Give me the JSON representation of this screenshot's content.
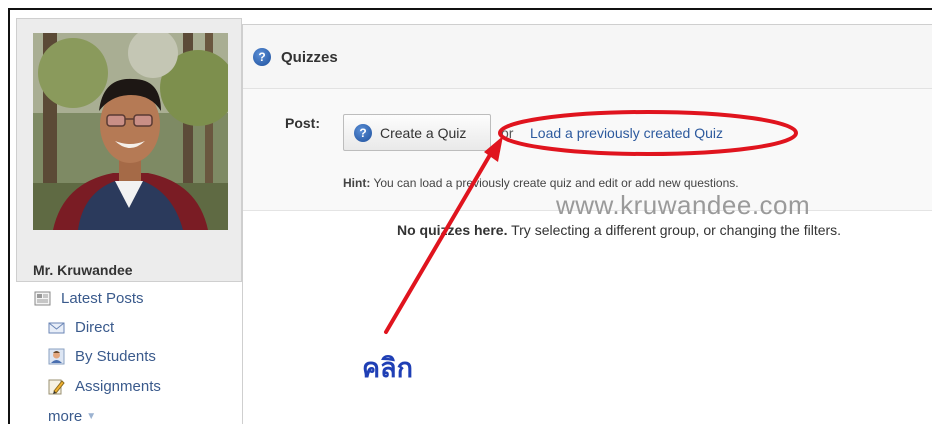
{
  "profile": {
    "name": "Mr. Kruwandee"
  },
  "nav": {
    "items": [
      {
        "label": "Latest Posts",
        "icon": "newspaper-icon"
      },
      {
        "label": "Direct",
        "icon": "envelope-icon"
      },
      {
        "label": "By Students",
        "icon": "student-icon"
      },
      {
        "label": "Assignments",
        "icon": "pencil-icon"
      }
    ],
    "more_label": "more"
  },
  "panel": {
    "title": "Quizzes",
    "post_label": "Post:",
    "create_button_label": "Create a Quiz",
    "or_text": "or",
    "load_link_label": "Load a previously created Quiz",
    "hint_label": "Hint:",
    "hint_text": "You can load a previously create quiz and edit or add new questions.",
    "empty_strong": "No quizzes here.",
    "empty_text": "Try selecting a different group, or changing the filters."
  },
  "watermark": "www.kruwandee.com",
  "annotation": {
    "click_label": "คลิก"
  },
  "colors": {
    "link": "#2d5a9e",
    "annotation_red": "#e0141e",
    "annotation_blue": "#1f3fb5"
  }
}
